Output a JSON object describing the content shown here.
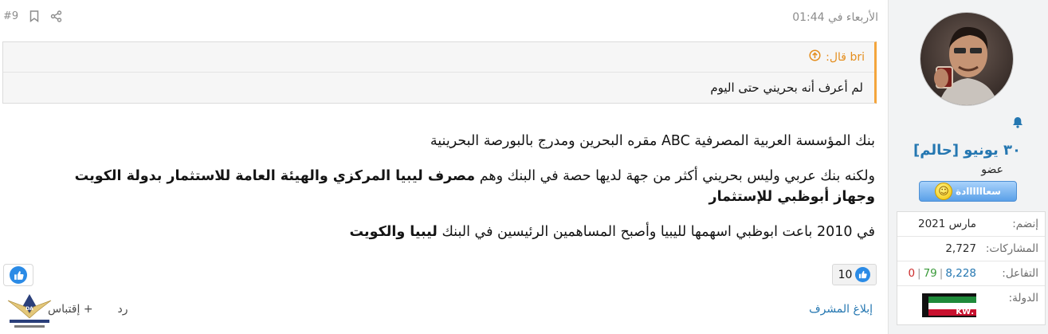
{
  "post": {
    "number": "#9",
    "date": "الأربعاء في 01:44",
    "quote": {
      "author_label": "bri قال:",
      "text": "لم أعرف أنه بحريني حتى اليوم"
    },
    "paragraph1": "بنك المؤسسة العربية المصرفية ABC مقره البحرين ومدرج بالبورصة البحرينية",
    "paragraph2_plain": "ولكنه بنك عربي وليس بحريني أكثر من جهة لديها حصة في البنك وهم ",
    "paragraph2_bold": "مصرف ليبيا المركزي والهيئة العامة للاستثمار بدولة الكويت وجهاز أبوظبي للإستثمار",
    "paragraph3_plain": "في 2010 باعت ابوظبي اسهمها لليبيا وأصبح المساهمين الرئيسين في البنك ",
    "paragraph3_bold": "ليبيا والكويت",
    "reaction_count": "10",
    "report_label": "إبلاغ المشرف",
    "quote_action_label": "+ إقتباس",
    "reply_label": "رد"
  },
  "user": {
    "name": "٣٠ يونيو [حالم]",
    "title": "عضو",
    "banner_text": "سعاااااادة",
    "stats": {
      "joined_label": "إنضم:",
      "joined_value": "مارس 2021",
      "posts_label": "المشاركات:",
      "posts_value": "2,727",
      "reactions_label": "التفاعل:",
      "reactions_positive": "8,228",
      "reactions_neutral": "79",
      "reactions_negative": "0",
      "country_label": "الدولة:",
      "country_flag_text": ".KW"
    }
  },
  "icons": {
    "share": "share-icon",
    "bookmark": "bookmark-icon",
    "quote_arrow": "arrow-up-circle-icon",
    "like": "thumbs-up-icon",
    "bell": "bell-icon"
  },
  "colors": {
    "link_blue": "#2577b1",
    "quote_accent": "#f4a53c",
    "like_blue": "#2b8be6"
  }
}
